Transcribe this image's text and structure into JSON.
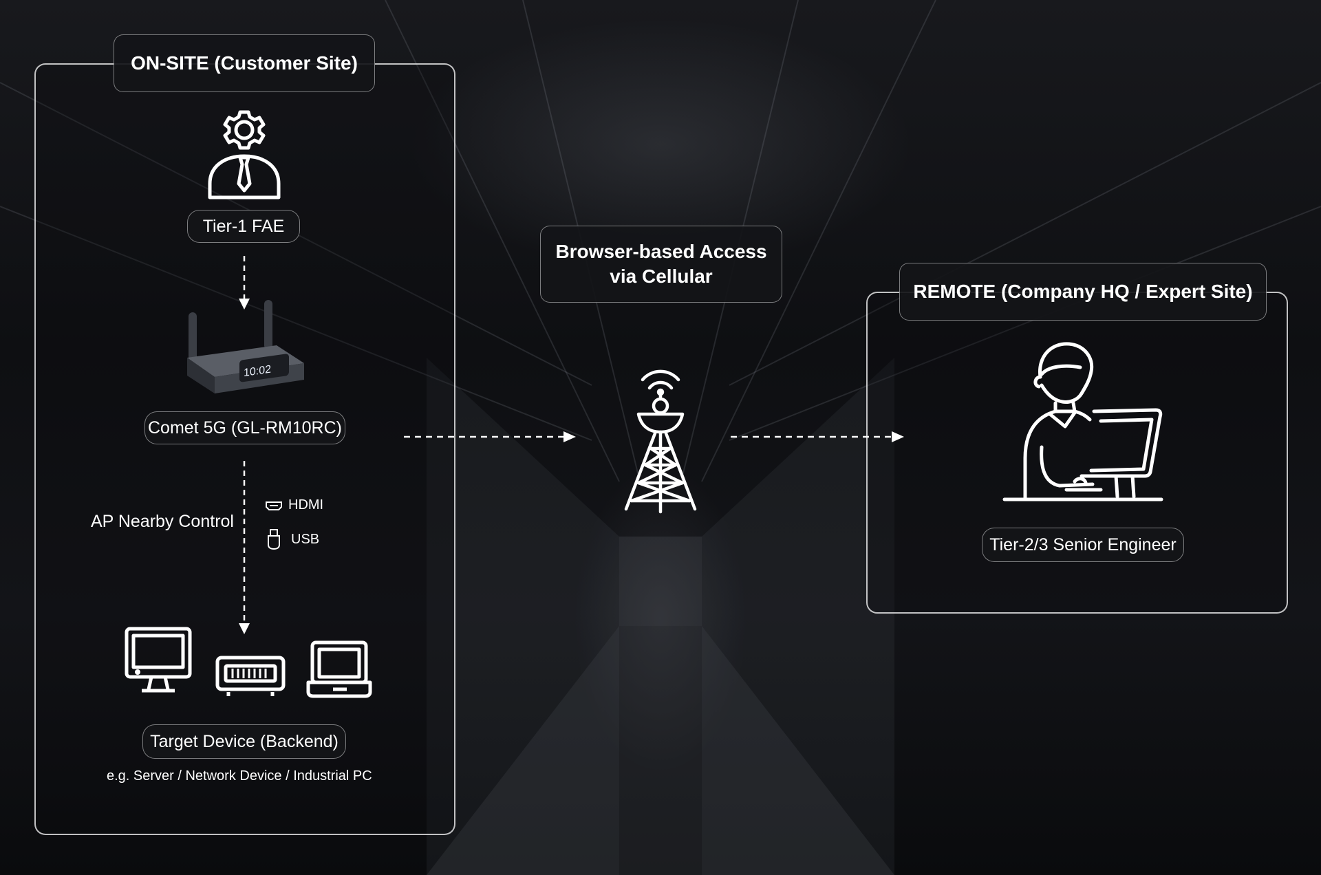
{
  "onsite": {
    "title": "ON-SITE (Customer Site)",
    "fae_label": "Tier-1 FAE",
    "router_label": "Comet 5G (GL-RM10RC)",
    "router_screen_time": "10:02",
    "control_label": "AP Nearby Control",
    "ports": [
      {
        "icon": "hdmi-icon",
        "label": "HDMI"
      },
      {
        "icon": "usb-icon",
        "label": "USB"
      }
    ],
    "target_label": "Target Device (Backend)",
    "target_examples": "e.g. Server / Network Device / Industrial PC"
  },
  "link": {
    "title_line1": "Browser-based Access",
    "title_line2": "via Cellular",
    "icon": "cell-tower-icon"
  },
  "remote": {
    "title": "REMOTE (Company HQ / Expert Site)",
    "engineer_label": "Tier-2/3 Senior Engineer"
  },
  "colors": {
    "line": "#ffffff",
    "panel_border": "#c8c8c8",
    "pill_bg": "#141518"
  }
}
